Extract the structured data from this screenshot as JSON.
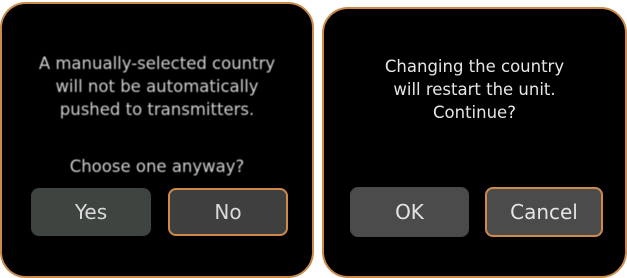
{
  "colors": {
    "panel_background": "#000000",
    "panel_border": "#c98a4b",
    "button_background": "#4b4b4b",
    "button_focus_border": "#d08a48",
    "text": "#e4e4e4"
  },
  "dialog_left": {
    "message": "A manually-selected country\nwill not be automatically\npushed to transmitters.",
    "question": "Choose one anyway?",
    "yes_label": "Yes",
    "no_label": "No"
  },
  "dialog_right": {
    "message": "Changing the country\nwill restart the unit.\nContinue?",
    "ok_label": "OK",
    "cancel_label": "Cancel"
  }
}
